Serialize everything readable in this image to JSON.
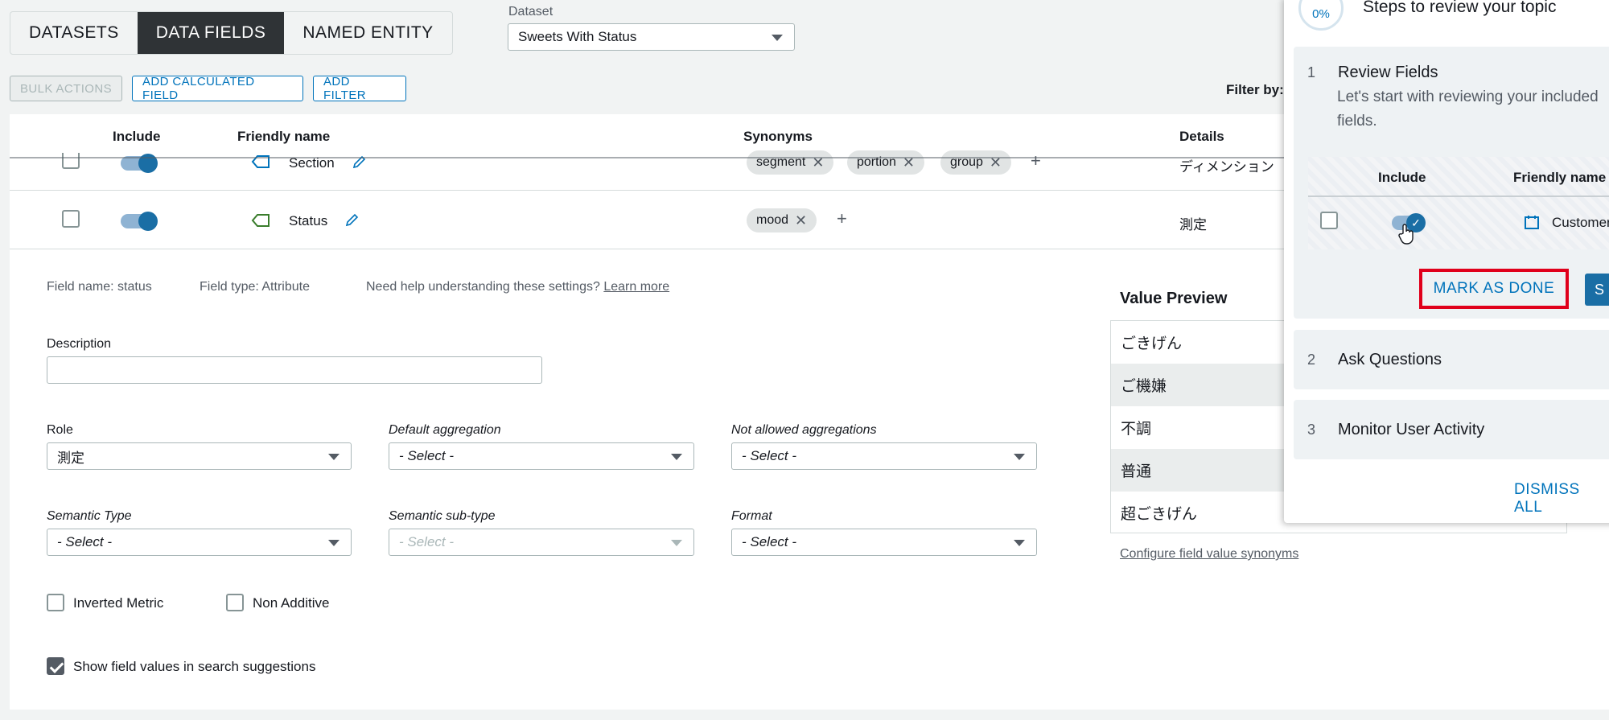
{
  "tabs": [
    {
      "label": "DATASETS",
      "active": false
    },
    {
      "label": "DATA FIELDS",
      "active": true
    },
    {
      "label": "NAMED ENTITY",
      "active": false
    }
  ],
  "dataset": {
    "label": "Dataset",
    "value": "Sweets With Status"
  },
  "toolbar": {
    "bulk_actions": "BULK ACTIONS",
    "add_calculated_field": "ADD CALCULATED FIELD",
    "add_filter": "ADD FILTER",
    "filter_by": "Filter by:"
  },
  "table": {
    "headers": {
      "include": "Include",
      "friendly_name": "Friendly name",
      "synonyms": "Synonyms",
      "details": "Details"
    },
    "rows": [
      {
        "name": "Section",
        "synonyms": [
          "segment",
          "portion",
          "group"
        ],
        "details": "ディメンション"
      },
      {
        "name": "Status",
        "synonyms": [
          "mood"
        ],
        "details": "測定"
      }
    ]
  },
  "details_panel": {
    "field_name": "Field name: status",
    "field_type": "Field type: Attribute",
    "help_text": "Need help understanding these settings?",
    "learn_more": "Learn more",
    "description_label": "Description",
    "description_value": "",
    "role_label": "Role",
    "role_value": "測定",
    "default_aggregation_label": "Default aggregation",
    "default_aggregation_value": "- Select -",
    "not_allowed_aggregations_label": "Not allowed aggregations",
    "not_allowed_aggregations_value": "- Select -",
    "semantic_type_label": "Semantic Type",
    "semantic_type_value": "- Select -",
    "semantic_subtype_label": "Semantic sub-type",
    "semantic_subtype_value": "- Select -",
    "format_label": "Format",
    "format_value": "- Select -",
    "inverted_metric": "Inverted Metric",
    "non_additive": "Non Additive",
    "show_values": "Show field values in search suggestions"
  },
  "value_preview": {
    "title": "Value Preview",
    "values": [
      "ごきげん",
      "ご機嫌",
      "不調",
      "普通",
      "超ごきげん"
    ],
    "configure_link": "Configure field value synonyms"
  },
  "side_panel": {
    "progress": "0%",
    "title": "Steps to review your topic",
    "steps": [
      {
        "num": "1",
        "title": "Review Fields",
        "desc": "Let's start with reviewing your included fields."
      },
      {
        "num": "2",
        "title": "Ask Questions"
      },
      {
        "num": "3",
        "title": "Monitor User Activity"
      }
    ],
    "mini_headers": {
      "include": "Include",
      "friendly_name": "Friendly name"
    },
    "mini_row_name": "Customer",
    "mark_as_done": "MARK AS DONE",
    "next_label": "S",
    "dismiss_all": "DISMISS ALL"
  }
}
